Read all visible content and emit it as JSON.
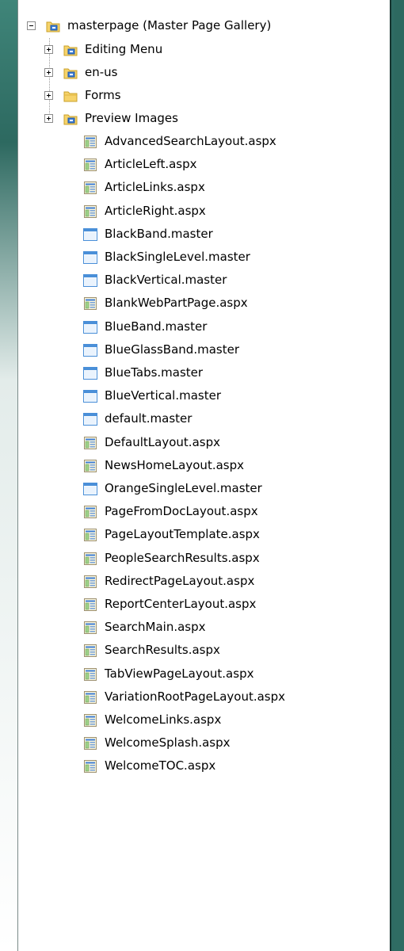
{
  "tree": {
    "root": {
      "label": "masterpage (Master Page Gallery)",
      "icon": "library-folder-icon",
      "expanded": true
    },
    "folders": [
      {
        "label": "Editing Menu",
        "icon": "library-folder-icon",
        "expanded": false
      },
      {
        "label": "en-us",
        "icon": "library-folder-icon",
        "expanded": false
      },
      {
        "label": "Forms",
        "icon": "folder-icon",
        "expanded": false
      },
      {
        "label": "Preview Images",
        "icon": "library-folder-icon",
        "expanded": false
      }
    ],
    "files": [
      {
        "label": "AdvancedSearchLayout.aspx",
        "type": "aspx"
      },
      {
        "label": "ArticleLeft.aspx",
        "type": "aspx"
      },
      {
        "label": "ArticleLinks.aspx",
        "type": "aspx"
      },
      {
        "label": "ArticleRight.aspx",
        "type": "aspx"
      },
      {
        "label": "BlackBand.master",
        "type": "master"
      },
      {
        "label": "BlackSingleLevel.master",
        "type": "master"
      },
      {
        "label": "BlackVertical.master",
        "type": "master"
      },
      {
        "label": "BlankWebPartPage.aspx",
        "type": "aspx"
      },
      {
        "label": "BlueBand.master",
        "type": "master"
      },
      {
        "label": "BlueGlassBand.master",
        "type": "master"
      },
      {
        "label": "BlueTabs.master",
        "type": "master"
      },
      {
        "label": "BlueVertical.master",
        "type": "master"
      },
      {
        "label": "default.master",
        "type": "master"
      },
      {
        "label": "DefaultLayout.aspx",
        "type": "aspx"
      },
      {
        "label": "NewsHomeLayout.aspx",
        "type": "aspx"
      },
      {
        "label": "OrangeSingleLevel.master",
        "type": "master"
      },
      {
        "label": "PageFromDocLayout.aspx",
        "type": "aspx"
      },
      {
        "label": "PageLayoutTemplate.aspx",
        "type": "aspx"
      },
      {
        "label": "PeopleSearchResults.aspx",
        "type": "aspx"
      },
      {
        "label": "RedirectPageLayout.aspx",
        "type": "aspx"
      },
      {
        "label": "ReportCenterLayout.aspx",
        "type": "aspx"
      },
      {
        "label": "SearchMain.aspx",
        "type": "aspx"
      },
      {
        "label": "SearchResults.aspx",
        "type": "aspx"
      },
      {
        "label": "TabViewPageLayout.aspx",
        "type": "aspx"
      },
      {
        "label": "VariationRootPageLayout.aspx",
        "type": "aspx"
      },
      {
        "label": "WelcomeLinks.aspx",
        "type": "aspx"
      },
      {
        "label": "WelcomeSplash.aspx",
        "type": "aspx"
      },
      {
        "label": "WelcomeTOC.aspx",
        "type": "aspx"
      }
    ]
  },
  "colors": {
    "background_teal": "#2e6b63",
    "folder_yellow": "#f6d36a",
    "library_blue": "#3f7fd6",
    "master_blue": "#4a8fd8"
  }
}
